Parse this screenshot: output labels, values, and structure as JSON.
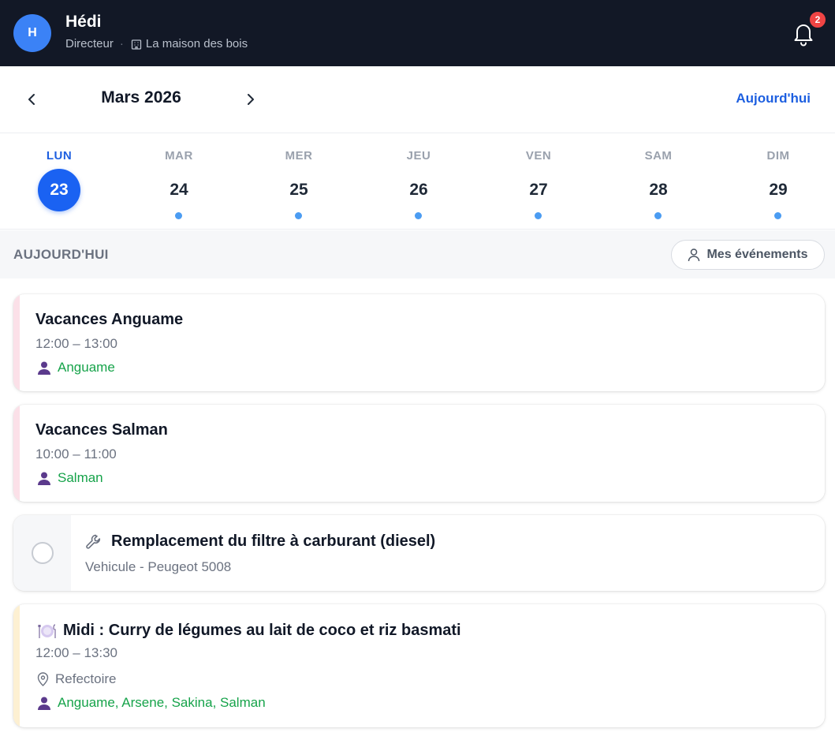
{
  "user": {
    "initial": "H",
    "name": "Hédi",
    "role": "Directeur",
    "separator": "·",
    "org": "La maison des bois"
  },
  "notifications": {
    "count": "2",
    "icon": "bell-icon"
  },
  "calendar": {
    "month_label": "Mars 2026",
    "prev_icon": "chevron-left-icon",
    "next_icon": "chevron-right-icon",
    "today_label": "Aujourd'hui",
    "days": [
      {
        "abbr": "LUN",
        "num": "23",
        "selected": true,
        "has_events": false
      },
      {
        "abbr": "MAR",
        "num": "24",
        "selected": false,
        "has_events": true
      },
      {
        "abbr": "MER",
        "num": "25",
        "selected": false,
        "has_events": true
      },
      {
        "abbr": "JEU",
        "num": "26",
        "selected": false,
        "has_events": true
      },
      {
        "abbr": "VEN",
        "num": "27",
        "selected": false,
        "has_events": true
      },
      {
        "abbr": "SAM",
        "num": "28",
        "selected": false,
        "has_events": true
      },
      {
        "abbr": "DIM",
        "num": "29",
        "selected": false,
        "has_events": true
      }
    ]
  },
  "section": {
    "title": "AUJOURD'HUI",
    "filter_label": "Mes événements",
    "filter_icon": "user-icon"
  },
  "events": [
    {
      "title": "Vacances Anguame",
      "time": "12:00 – 13:00",
      "people": "Anguame",
      "stripe_color": "#fbe0e8"
    },
    {
      "title": "Vacances Salman",
      "time": "10:00 – 11:00",
      "people": "Salman",
      "stripe_color": "#fbe0e8"
    },
    {
      "title": "Remplacement du filtre à carburant (diesel)",
      "subtitle": "Vehicule - Peugeot 5008",
      "icon": "wrench-icon"
    },
    {
      "title": "Midi : Curry de légumes au lait de coco et riz basmati",
      "icon": "plate-icon",
      "time": "12:00 – 13:30",
      "location": "Refectoire",
      "people": "Anguame, Arsene, Sakina, Salman",
      "stripe_color": "#fdf0d2"
    }
  ],
  "colors": {
    "header_bg": "#121826",
    "accent": "#1a62f2",
    "people": "#16a34a",
    "badge": "#ef4444"
  }
}
